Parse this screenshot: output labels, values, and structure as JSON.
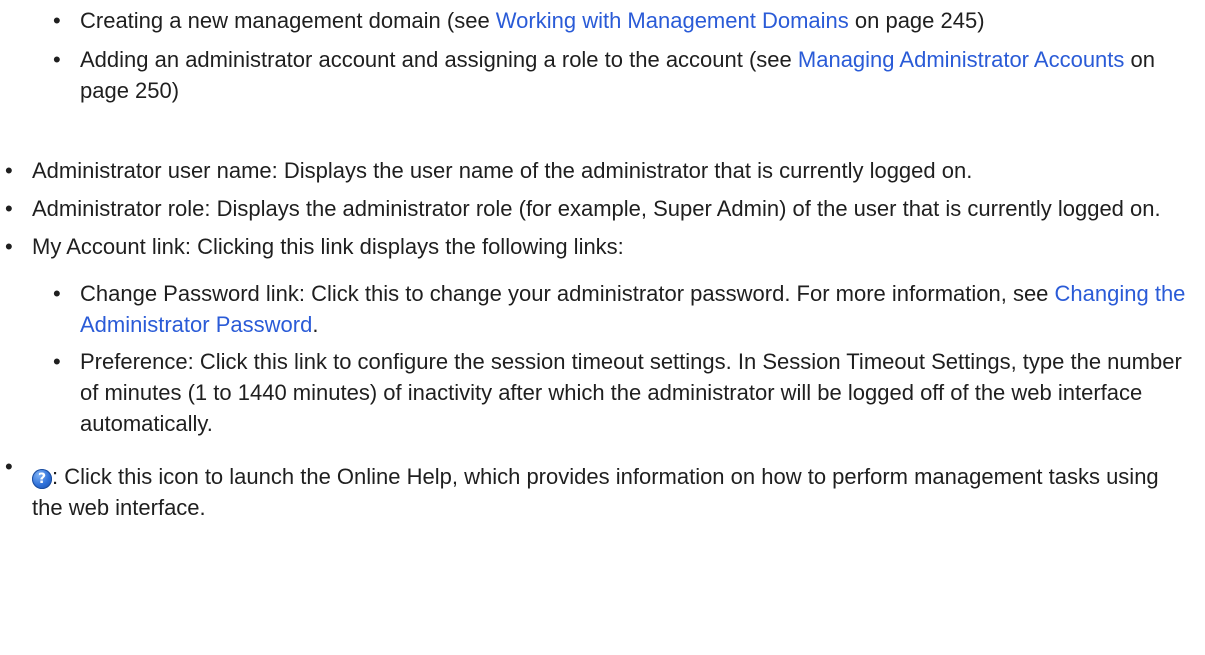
{
  "top_bullets": [
    {
      "prefix": "Creating a new management domain (see ",
      "link": "Working with Management Domains",
      "suffix": " on page 245)"
    },
    {
      "prefix": "Adding an administrator account and assigning a role to the account (see ",
      "link": "Managing Administrator Accounts",
      "suffix": " on page 250)"
    }
  ],
  "main_bullets": {
    "user_name": "Administrator user name: Displays the user name of the administrator that is currently logged on.",
    "role": "Administrator role: Displays the administrator role (for example, Super Admin) of the user that is currently logged on.",
    "my_account": "My Account link: Clicking this link displays the following links:",
    "change_password": {
      "prefix": "Change Password link: Click this to change your administrator password. For more information, see ",
      "link": "Changing the Administrator Password",
      "suffix": "."
    },
    "preference": "Preference: Click this link to configure the session timeout settings. In Session Timeout Settings, type the number of minutes (1 to 1440 minutes) of inactivity after which the administrator will be logged off of the web interface automatically.",
    "help": {
      "icon": "help-icon",
      "icon_glyph": "?",
      "text": ": Click this icon to launch the Online Help, which provides information on how to perform management tasks using the web interface."
    }
  }
}
